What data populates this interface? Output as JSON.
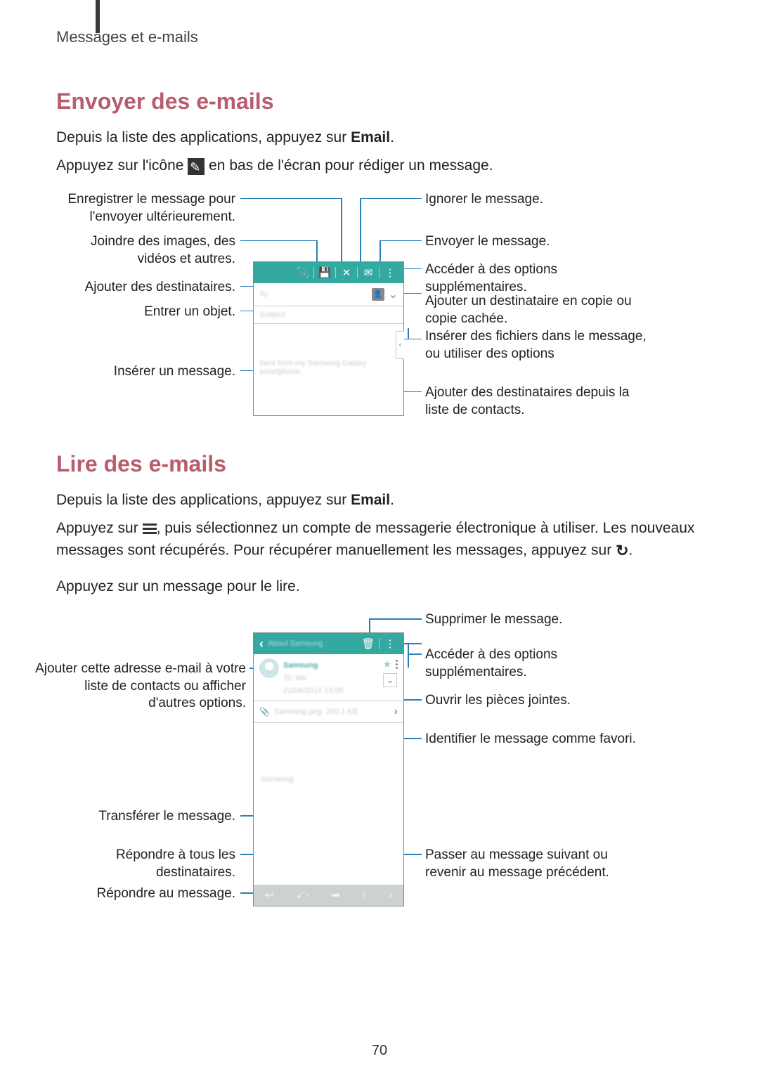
{
  "page": {
    "breadcrumb": "Messages et e-mails",
    "page_number": "70"
  },
  "section1": {
    "heading": "Envoyer des e-mails",
    "p1_a": "Depuis la liste des applications, appuyez sur ",
    "p1_b": "Email",
    "p1_c": ".",
    "p2_a": "Appuyez sur l'icône ",
    "p2_b": " en bas de l'écran pour rédiger un message."
  },
  "labels1": {
    "left": {
      "l1": "Enregistrer le message pour l'envoyer ultérieurement.",
      "l2": "Joindre des images, des vidéos et autres.",
      "l3": "Ajouter des destinataires.",
      "l4": "Entrer un objet.",
      "l5": "Insérer un message."
    },
    "right": {
      "r1": "Ignorer le message.",
      "r2": "Envoyer le message.",
      "r3": "Accéder à des options supplémentaires.",
      "r4": "Ajouter un destinataire en copie ou copie cachée.",
      "r5": "Insérer des fichiers dans le message, ou utiliser des options",
      "r6": "Ajouter des destinataires depuis la liste de contacts."
    }
  },
  "phone1_blur": {
    "to": "To",
    "subject": "Subject",
    "body": "Sent from my Samsung Galaxy smartphone."
  },
  "section2": {
    "heading": "Lire des e-mails",
    "p1_a": "Depuis la liste des applications, appuyez sur ",
    "p1_b": "Email",
    "p1_c": ".",
    "p2_a": "Appuyez sur ",
    "p2_b": ", puis sélectionnez un compte de messagerie électronique à utiliser. Les nouveaux messages sont récupérés. Pour récupérer manuellement les messages, appuyez sur ",
    "p2_c": ".",
    "p3": "Appuyez sur un message pour le lire."
  },
  "labels2": {
    "left": {
      "l1": "Ajouter cette adresse e-mail à votre liste de contacts ou afficher d'autres options.",
      "l2": "Transférer le message.",
      "l3": "Répondre à tous les destinataires.",
      "l4": "Répondre au message."
    },
    "right": {
      "r1": "Supprimer le message.",
      "r2": "Accéder à des options supplémentaires.",
      "r3": "Ouvrir les pièces jointes.",
      "r4": "Identifier le message comme favori.",
      "r5": "Passer au message suivant ou revenir au message précédent."
    }
  },
  "phone2_blur": {
    "toolbar_title": "About Samsung",
    "sender": "Samsung",
    "to": "To: Me",
    "date": "21/08/2014 13:05",
    "attach": "Samsung.png",
    "attach_size": "200.1 KB",
    "body_sig": "Samsung"
  },
  "icons": {
    "attach": "📎",
    "save": "💾",
    "close": "✕",
    "send": "✉",
    "more": "⋮",
    "chevron_down": "⌄",
    "chevron_left": "‹",
    "chevron_right": "›",
    "trash": "🗑",
    "back": "‹",
    "reply": "↩",
    "reply_all": "⤺",
    "forward": "➡",
    "refresh": "↻"
  }
}
